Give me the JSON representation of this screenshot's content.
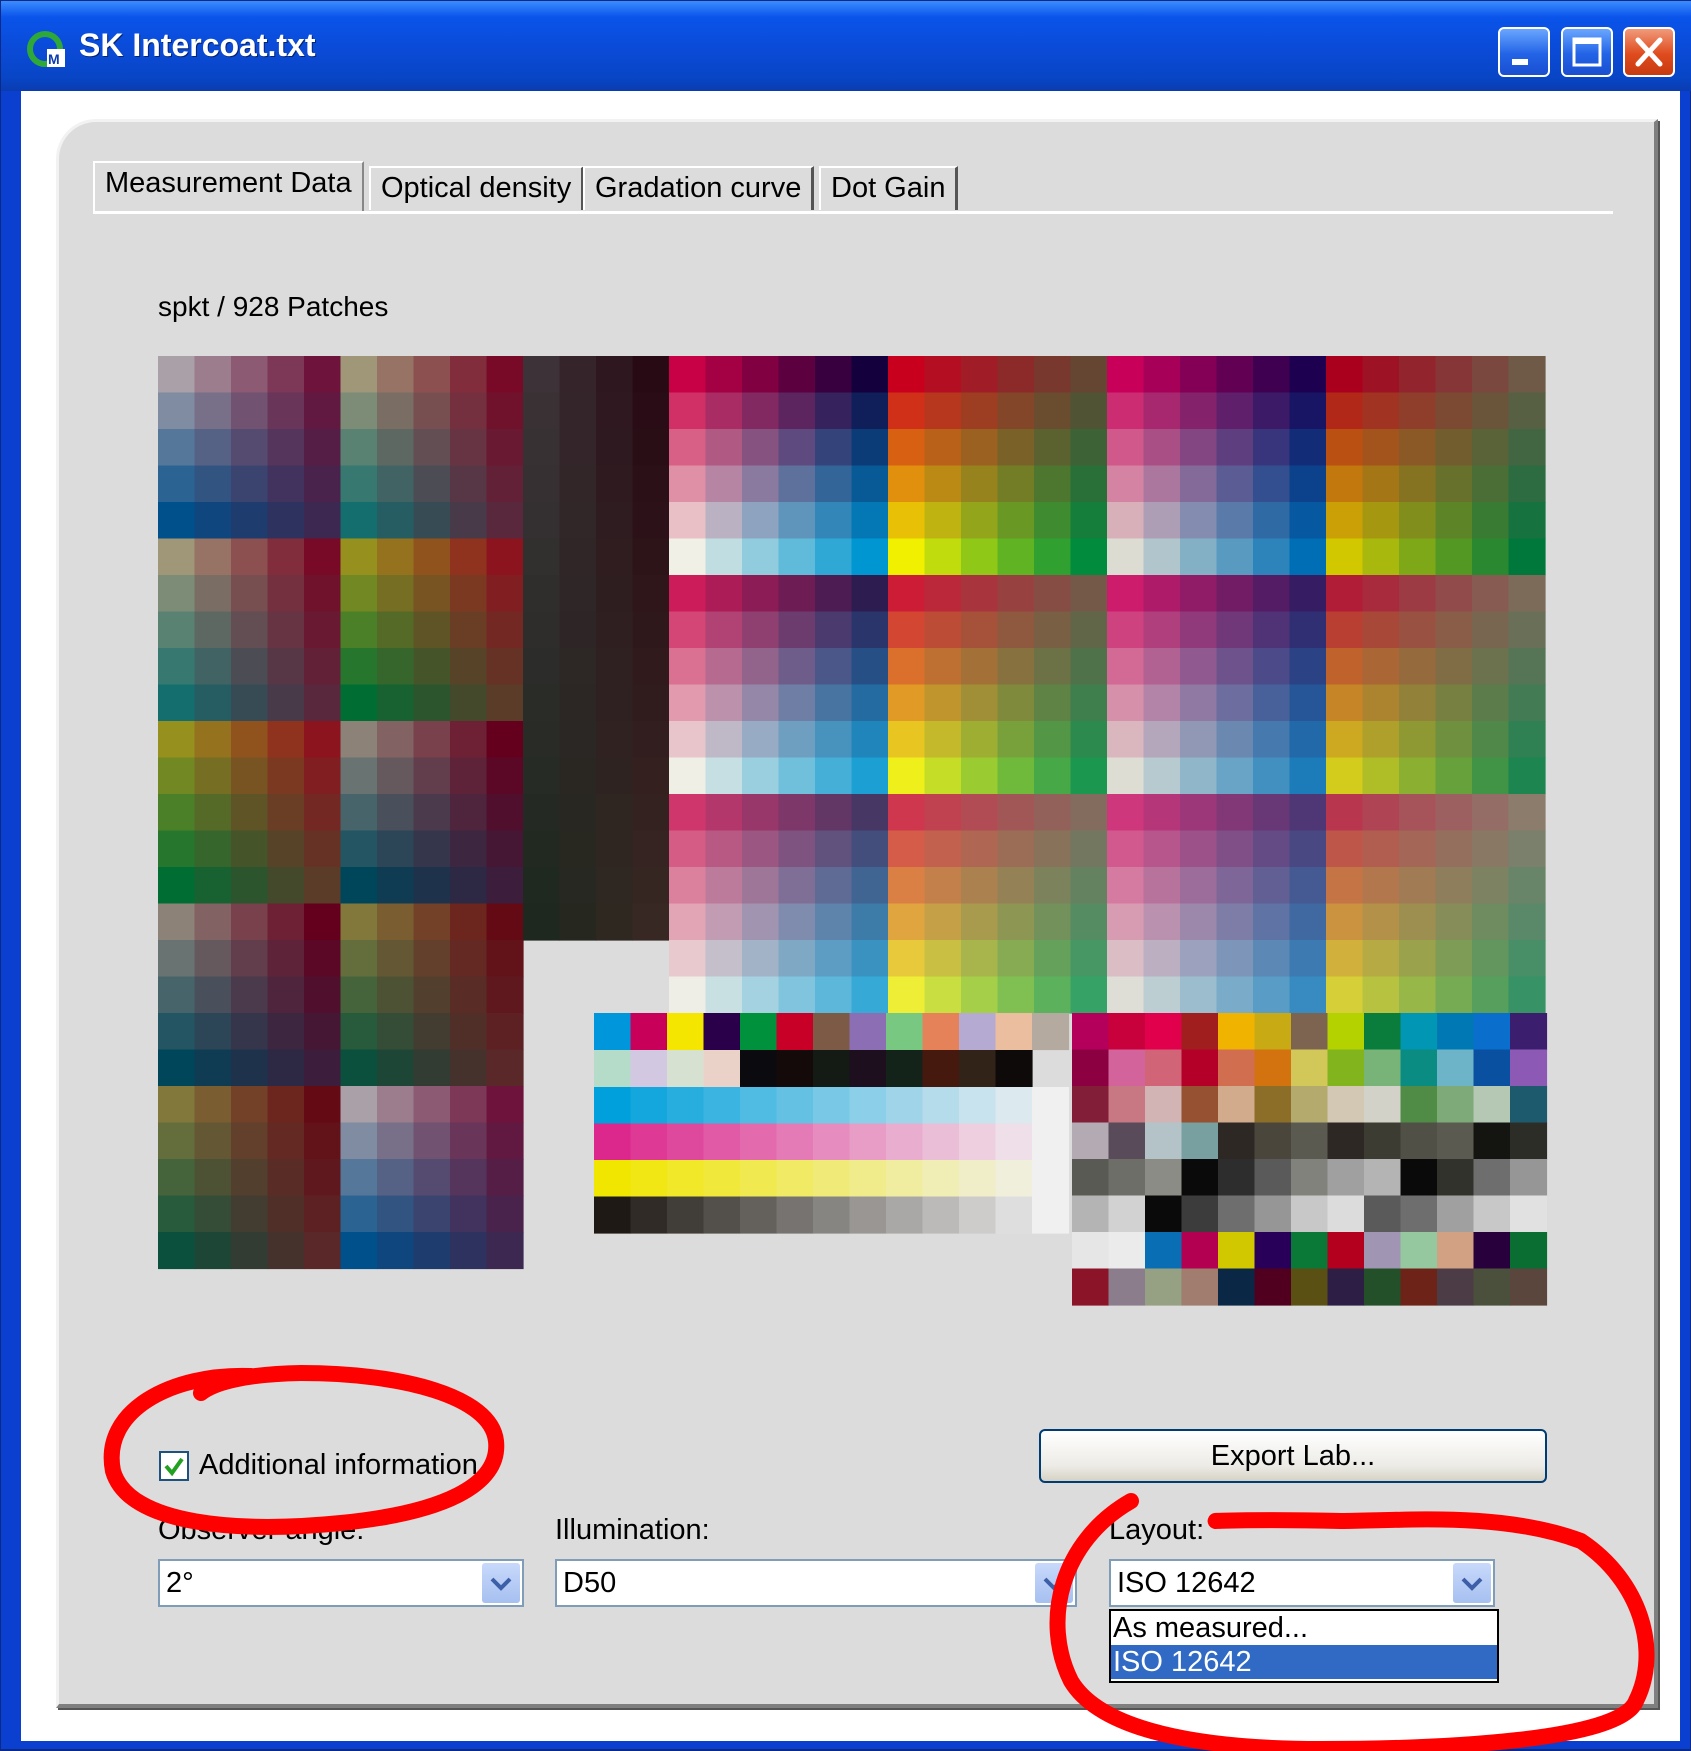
{
  "window": {
    "title": "SK Intercoat.txt",
    "buttons": [
      "minimize",
      "maximize",
      "close"
    ]
  },
  "tabs": [
    {
      "label": "Measurement Data",
      "active": true
    },
    {
      "label": "Optical density",
      "active": false
    },
    {
      "label": "Gradation curve",
      "active": false
    },
    {
      "label": "Dot Gain",
      "active": false
    }
  ],
  "patch_info": "spkt / 928 Patches",
  "additional_info": {
    "label": "Additional information",
    "checked": true
  },
  "observer": {
    "label": "Observer angle:",
    "value": "2°"
  },
  "illumination": {
    "label": "Illumination:",
    "value": "D50"
  },
  "layout": {
    "label": "Layout:",
    "value": "ISO 12642",
    "options": [
      "As measured...",
      "ISO 12642"
    ],
    "selected_option": "ISO 12642"
  },
  "export_button": "Export Lab...",
  "colors": {
    "titlebar": "#0a54ea",
    "selection": "#316ac5",
    "annotation": "#ff0000"
  }
}
